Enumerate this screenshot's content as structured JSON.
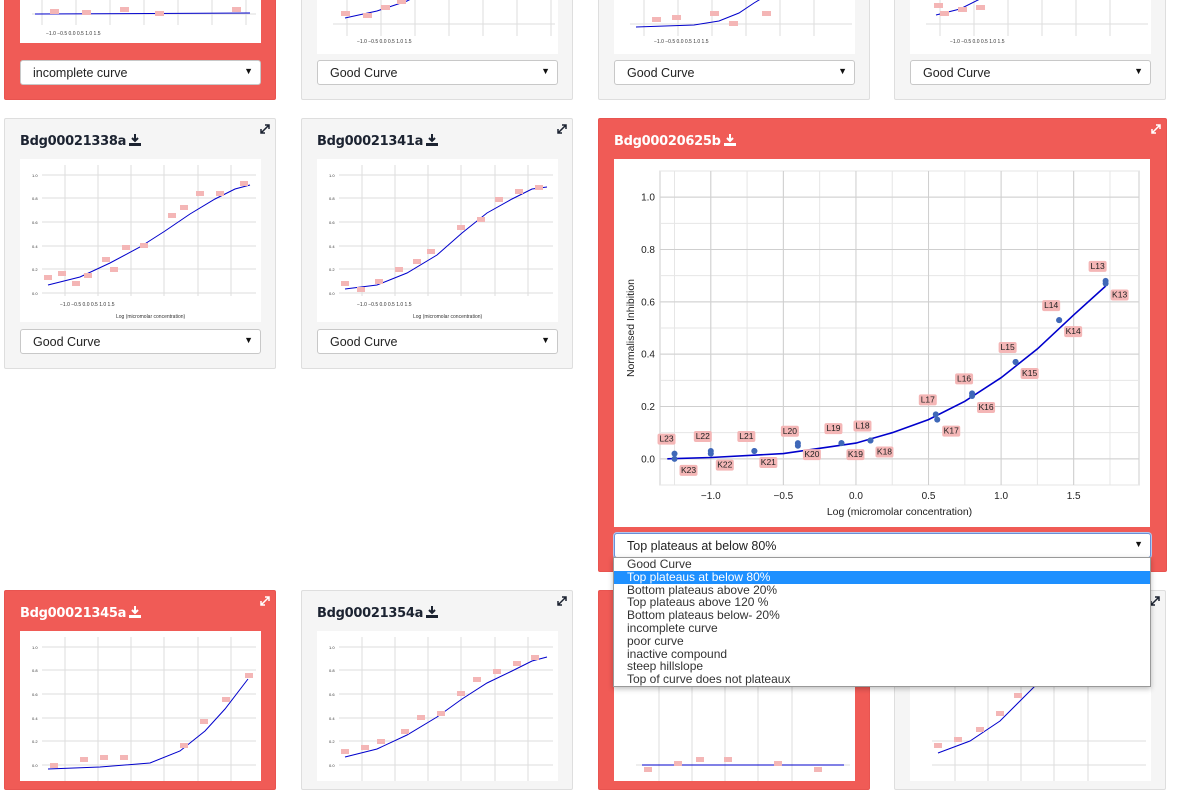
{
  "select_options": [
    "Good Curve",
    "Top plateaus at below 80%",
    "Bottom plateaus above 20%",
    "Top plateaus above 120 %",
    "Bottom plateaus below- 20%",
    "incomplete curve",
    "poor curve",
    "inactive compound",
    "steep hillslope",
    "Top of curve does not plateaux"
  ],
  "top_row": {
    "select_values": [
      "incomplete curve",
      "Good Curve",
      "Good Curve",
      "Good Curve"
    ]
  },
  "cards": {
    "c1338": {
      "title": "Bdg00021338a",
      "select": "Good Curve"
    },
    "c1341": {
      "title": "Bdg00021341a",
      "select": "Good Curve"
    },
    "c0625": {
      "title": "Bdg00020625b",
      "select": "Top plateaus at below 80%"
    },
    "c1345": {
      "title": "Bdg00021345a"
    },
    "c1354": {
      "title": "Bdg00021354a"
    }
  },
  "colors": {
    "highlight": "#f05b56",
    "curve": "#0000cc",
    "point": "#3f68b8",
    "label_bg": "#f4b6b6"
  },
  "icons": {
    "download": "download-icon",
    "expand": "expand-icon",
    "dropdown_arrow": "caret-down-icon"
  },
  "chart_data": [
    {
      "type": "scatter",
      "title": "",
      "xlabel": "Log (micromolar concentration)",
      "ylabel": "Normalised Inhibition",
      "xlim": [
        -1.35,
        1.95
      ],
      "ylim": [
        -0.1,
        1.1
      ],
      "xticks": [
        "−1.0",
        "−0.5",
        "0.0",
        "0.5",
        "1.0",
        "1.5"
      ],
      "yticks": [
        "0.0",
        "0.2",
        "0.4",
        "0.6",
        "0.8",
        "1.0"
      ],
      "grid": true,
      "points": [
        {
          "label": "L13",
          "x": 1.72,
          "y": 0.68
        },
        {
          "label": "K13",
          "x": 1.72,
          "y": 0.67
        },
        {
          "label": "L14",
          "x": 1.4,
          "y": 0.53
        },
        {
          "label": "K14",
          "x": 1.4,
          "y": 0.53
        },
        {
          "label": "L15",
          "x": 1.1,
          "y": 0.37
        },
        {
          "label": "K15",
          "x": 1.1,
          "y": 0.37
        },
        {
          "label": "L16",
          "x": 0.8,
          "y": 0.25
        },
        {
          "label": "K16",
          "x": 0.8,
          "y": 0.24
        },
        {
          "label": "L17",
          "x": 0.55,
          "y": 0.17
        },
        {
          "label": "K17",
          "x": 0.56,
          "y": 0.15
        },
        {
          "label": "L18",
          "x": 0.1,
          "y": 0.07
        },
        {
          "label": "K18",
          "x": 0.1,
          "y": 0.07
        },
        {
          "label": "L19",
          "x": -0.1,
          "y": 0.06
        },
        {
          "label": "K19",
          "x": -0.1,
          "y": 0.06
        },
        {
          "label": "L20",
          "x": -0.4,
          "y": 0.05
        },
        {
          "label": "K20",
          "x": -0.4,
          "y": 0.06
        },
        {
          "label": "L21",
          "x": -0.7,
          "y": 0.03
        },
        {
          "label": "K21",
          "x": -0.7,
          "y": 0.03
        },
        {
          "label": "L22",
          "x": -1.0,
          "y": 0.03
        },
        {
          "label": "K22",
          "x": -1.0,
          "y": 0.02
        },
        {
          "label": "L23",
          "x": -1.25,
          "y": 0.02
        },
        {
          "label": "K23",
          "x": -1.25,
          "y": 0.0
        }
      ],
      "curve": [
        [
          -1.3,
          0.0
        ],
        [
          -1.0,
          0.005
        ],
        [
          -0.5,
          0.02
        ],
        [
          0.0,
          0.06
        ],
        [
          0.25,
          0.1
        ],
        [
          0.5,
          0.15
        ],
        [
          0.75,
          0.22
        ],
        [
          1.0,
          0.31
        ],
        [
          1.25,
          0.42
        ],
        [
          1.5,
          0.55
        ],
        [
          1.72,
          0.66
        ]
      ]
    }
  ]
}
